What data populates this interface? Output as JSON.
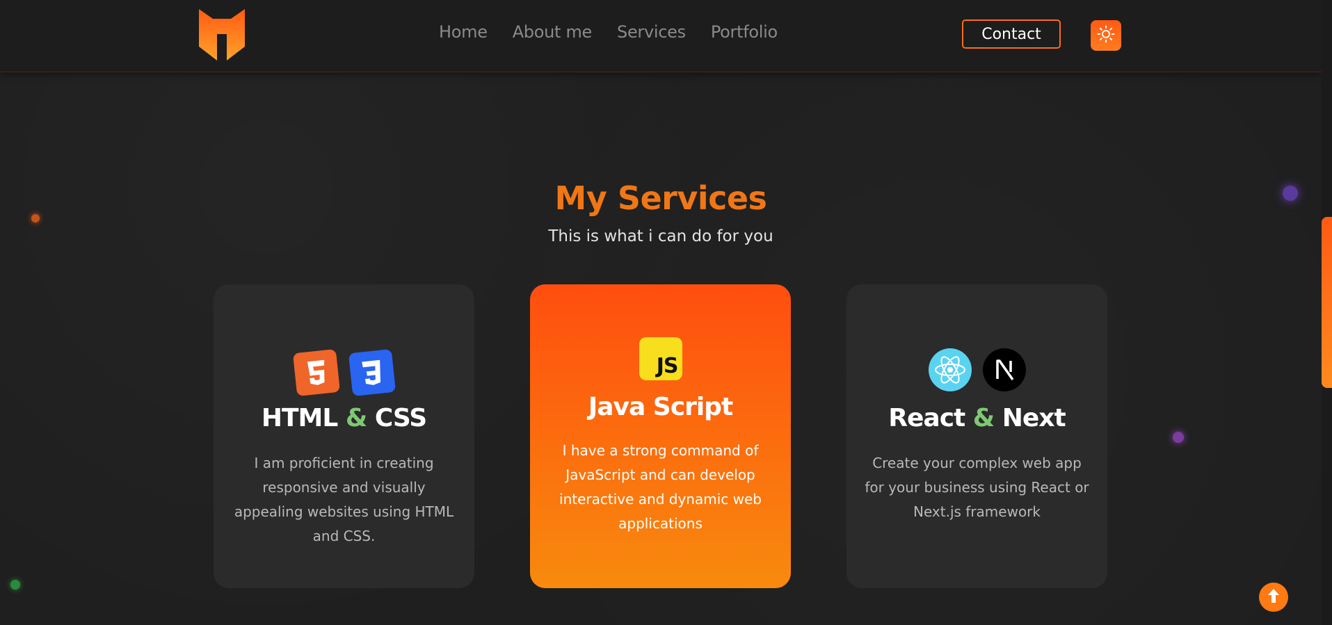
{
  "header": {
    "logo_icon": "m-shield-logo",
    "nav": [
      "Home",
      "About me",
      "Services",
      "Portfolio"
    ],
    "contact_label": "Contact",
    "theme_icon": "sun-icon"
  },
  "services": {
    "title": "My Services",
    "subtitle": "This is what i can do for you",
    "cards": [
      {
        "title_a": "HTML",
        "amp": "&",
        "title_b": "CSS",
        "description": "I am proficient in creating responsive and visually appealing websites using HTML and CSS.",
        "icons": [
          "html5-icon",
          "css3-icon"
        ]
      },
      {
        "title": "Java Script",
        "description": "I have a strong command of JavaScript and can develop interactive and dynamic web applications",
        "icons": [
          "javascript-icon"
        ],
        "js_badge": "JS"
      },
      {
        "title_a": "React",
        "amp": "&",
        "title_b": "Next",
        "description": "Create your complex web app for your business using React or Next.js framework",
        "icons": [
          "react-icon",
          "nextjs-icon"
        ]
      }
    ]
  },
  "colors": {
    "accent": "#ff6a1a",
    "title_orange": "#f07716",
    "amp_green": "#7fc873",
    "card_bg": "#2b2b2b"
  },
  "scroll_top_icon": "arrow-up-icon"
}
